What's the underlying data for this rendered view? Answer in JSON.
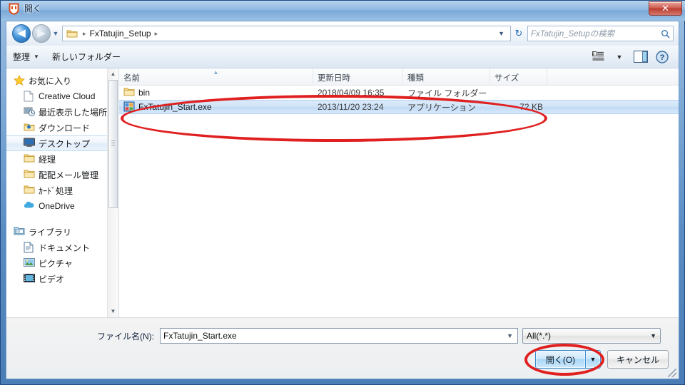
{
  "window": {
    "title": "開く",
    "app_icon": "shield-icon",
    "close_label": "✕"
  },
  "address_bar": {
    "back_label": "◀",
    "forward_label": "▶",
    "history_caret": "▼",
    "folder_icon": "folder-icon",
    "breadcrumb": [
      {
        "label": "FxTatujin_Setup"
      }
    ],
    "sep": "▸",
    "dropdown_caret": "▼",
    "refresh_icon": "↻",
    "search_placeholder": "FxTatujin_Setupの検索",
    "search_value": "",
    "search_icon": "search-icon"
  },
  "toolbar": {
    "organize_label": "整理",
    "organize_caret": "▼",
    "new_folder_label": "新しいフォルダー",
    "view_icon": "list-view-icon",
    "view_caret": "▼",
    "preview_pane_icon": "preview-pane-icon",
    "help_icon": "help-icon"
  },
  "sidebar": {
    "items": [
      {
        "label": "お気に入り",
        "icon": "star-icon",
        "indent": false,
        "selected": false
      },
      {
        "label": "Creative Cloud",
        "icon": "file-icon",
        "indent": true,
        "selected": false
      },
      {
        "label": "最近表示した場所",
        "icon": "recent-places-icon",
        "indent": true,
        "selected": false
      },
      {
        "label": "ダウンロード",
        "icon": "downloads-icon",
        "indent": true,
        "selected": false
      },
      {
        "label": "デスクトップ",
        "icon": "desktop-icon",
        "indent": true,
        "selected": true
      },
      {
        "label": "経理",
        "icon": "folder-icon",
        "indent": true,
        "selected": false
      },
      {
        "label": "配配メール管理",
        "icon": "folder-icon",
        "indent": true,
        "selected": false
      },
      {
        "label": "ｶｰﾄﾞ処理",
        "icon": "folder-icon",
        "indent": true,
        "selected": false
      },
      {
        "label": "OneDrive",
        "icon": "onedrive-icon",
        "indent": true,
        "selected": false
      },
      {
        "label": "ライブラリ",
        "icon": "library-icon",
        "indent": false,
        "selected": false
      },
      {
        "label": "ドキュメント",
        "icon": "document-icon",
        "indent": true,
        "selected": false
      },
      {
        "label": "ピクチャ",
        "icon": "pictures-icon",
        "indent": true,
        "selected": false
      },
      {
        "label": "ビデオ",
        "icon": "videos-icon",
        "indent": true,
        "selected": false
      }
    ],
    "scroll_up": "▲",
    "scroll_down": "▼"
  },
  "file_list": {
    "columns": [
      {
        "key": "name",
        "label": "名前",
        "sorted": "asc"
      },
      {
        "key": "date",
        "label": "更新日時",
        "sorted": ""
      },
      {
        "key": "type",
        "label": "種類",
        "sorted": ""
      },
      {
        "key": "size",
        "label": "サイズ",
        "sorted": ""
      }
    ],
    "sort_indicator": "▲",
    "rows": [
      {
        "name": "bin",
        "date": "2018/04/09 16:35",
        "type": "ファイル フォルダー",
        "size": "",
        "icon": "folder-icon",
        "selected": false
      },
      {
        "name": "FxTatujin_Start.exe",
        "date": "2013/11/20 23:24",
        "type": "アプリケーション",
        "size": "72 KB",
        "icon": "exe-icon",
        "selected": true
      }
    ]
  },
  "footer": {
    "filename_label": "ファイル名(N):",
    "filename_value": "FxTatujin_Start.exe",
    "filename_caret": "▼",
    "filetype_value": "All(*.*)",
    "filetype_caret": "▼",
    "open_label": "開く(O)",
    "open_caret": "▼",
    "cancel_label": "キャンセル"
  },
  "annotations": {
    "accent_color": "#e02020",
    "shapes": [
      {
        "name": "ellipse-around-file-row",
        "target": "FxTatujin_Start.exe"
      },
      {
        "name": "ellipse-around-open-button",
        "target": "開く(O)"
      }
    ]
  }
}
